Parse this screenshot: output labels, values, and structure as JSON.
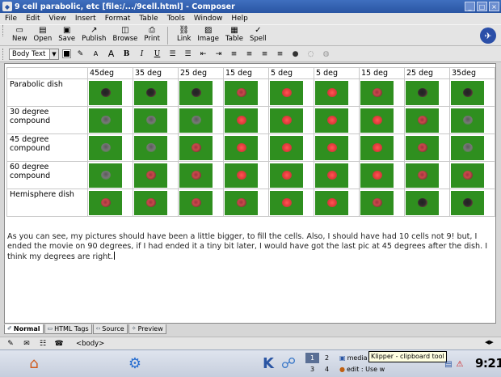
{
  "window": {
    "title": "9 cell parabolic, etc [file:/.../9cell.html] - Composer",
    "controls": {
      "minimize": "_",
      "maximize": "□",
      "close": "×"
    }
  },
  "menu": [
    "File",
    "Edit",
    "View",
    "Insert",
    "Format",
    "Table",
    "Tools",
    "Window",
    "Help"
  ],
  "toolbar": {
    "buttons": [
      {
        "label": "New",
        "icon": "new-doc-icon",
        "glyph": "▭"
      },
      {
        "label": "Open",
        "icon": "open-folder-icon",
        "glyph": "▤"
      },
      {
        "label": "Save",
        "icon": "save-icon",
        "glyph": "▣"
      },
      {
        "label": "Publish",
        "icon": "publish-icon",
        "glyph": "↗"
      },
      {
        "label": "Browse",
        "icon": "browse-icon",
        "glyph": "◫"
      },
      {
        "label": "Print",
        "icon": "print-icon",
        "glyph": "⎙"
      },
      {
        "label": "Link",
        "icon": "link-icon",
        "glyph": "⛓"
      },
      {
        "label": "Image",
        "icon": "image-icon",
        "glyph": "▨"
      },
      {
        "label": "Table",
        "icon": "table-icon",
        "glyph": "▦"
      },
      {
        "label": "Spell",
        "icon": "spell-icon",
        "glyph": "✓"
      }
    ]
  },
  "format": {
    "paragraph_style": "Body Text",
    "text_color": "#000000",
    "icons": [
      {
        "name": "highlight-icon",
        "glyph": "✎"
      },
      {
        "name": "smaller-font-icon",
        "glyph": "A"
      },
      {
        "name": "larger-font-icon",
        "glyph": "A"
      },
      {
        "name": "bold-icon",
        "glyph": "B"
      },
      {
        "name": "italic-icon",
        "glyph": "I"
      },
      {
        "name": "underline-icon",
        "glyph": "U"
      },
      {
        "name": "bullet-list-icon",
        "glyph": "☰"
      },
      {
        "name": "numbered-list-icon",
        "glyph": "☰"
      },
      {
        "name": "outdent-icon",
        "glyph": "⇤"
      },
      {
        "name": "indent-icon",
        "glyph": "⇥"
      },
      {
        "name": "align-left-icon",
        "glyph": "≡"
      },
      {
        "name": "align-center-icon",
        "glyph": "≡"
      },
      {
        "name": "align-right-icon",
        "glyph": "≡"
      },
      {
        "name": "justify-icon",
        "glyph": "≡"
      },
      {
        "name": "anchor-icon",
        "glyph": "●"
      },
      {
        "name": "hr-icon",
        "glyph": "◌"
      },
      {
        "name": "form-icon",
        "glyph": "◍"
      }
    ]
  },
  "document": {
    "header_row": [
      "",
      "45deg",
      "35 deg",
      "25 deg",
      "15 deg",
      "5 deg",
      "5 deg",
      "15 deg",
      "25 deg",
      "35deg"
    ],
    "rows": [
      {
        "label": "Parabolic dish",
        "cells": [
          "dark",
          "dark",
          "dark",
          "redd",
          "red",
          "red",
          "redd",
          "dark",
          "dark"
        ]
      },
      {
        "label": "30 degree compound",
        "cells": [
          "grey",
          "grey",
          "grey",
          "red",
          "red",
          "red",
          "red",
          "redd",
          "grey"
        ]
      },
      {
        "label": "45 degree compound",
        "cells": [
          "grey",
          "grey",
          "redd",
          "red",
          "red",
          "red",
          "red",
          "redd",
          "grey"
        ]
      },
      {
        "label": "60 degree compound",
        "cells": [
          "grey",
          "redd",
          "redd",
          "red",
          "red",
          "red",
          "red",
          "redd",
          "redd"
        ]
      },
      {
        "label": "Hemisphere dish",
        "cells": [
          "redd",
          "redd",
          "redd",
          "redd",
          "red",
          "red",
          "redd",
          "dark",
          "dark"
        ]
      }
    ],
    "paragraph": "As you can see, my pictures should have been a little bigger, to fill the cells. Also, I should have had 10 cells not 9! but, I ended the movie on 90 degrees, if I had ended it a tiny bit later, I would have got the last pic at 45 degrees after the dish. I think my degrees are right."
  },
  "mode_tabs": [
    {
      "label": "Normal",
      "icon": "normal-mode-icon",
      "glyph": "✐",
      "active": true
    },
    {
      "label": "HTML Tags",
      "icon": "html-tags-icon",
      "glyph": "▭",
      "active": false
    },
    {
      "label": "Source",
      "icon": "source-icon",
      "glyph": "‹›",
      "active": false
    },
    {
      "label": "Preview",
      "icon": "preview-icon",
      "glyph": "✧",
      "active": false
    }
  ],
  "status": {
    "tag": "<body>"
  },
  "taskbar": {
    "pager": [
      "1",
      "2",
      "3",
      "4"
    ],
    "tasks": [
      "media",
      "edit : Use w"
    ],
    "tooltip": "Klipper - clipboard tool",
    "clock": "9:21"
  }
}
